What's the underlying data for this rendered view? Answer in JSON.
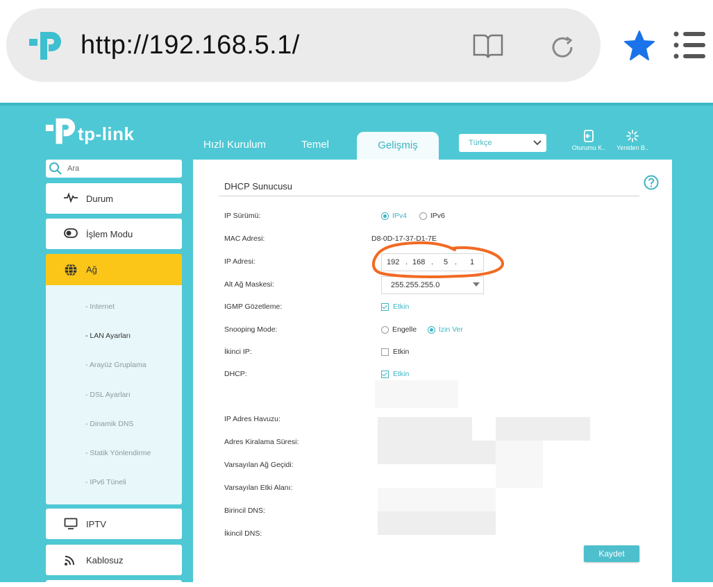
{
  "browser": {
    "url": "http://192.168.5.1/",
    "accent": "#1a73e8"
  },
  "router": {
    "brand": "tp-link",
    "tabs": [
      "Hızlı Kurulum",
      "Temel",
      "Gelişmiş"
    ],
    "active_tab": "Gelişmiş",
    "language": "Türkçe",
    "logout_label": "Oturumu K..",
    "reboot_label": "Yeniden B..",
    "theme_color": "#4ec8d4",
    "highlight_color": "#fcc619"
  },
  "sidebar": {
    "search_placeholder": "Ara",
    "items": {
      "durum": "Durum",
      "islem": "İşlem Modu",
      "ag": "Ağ",
      "iptv": "IPTV",
      "kablosuz": "Kablosuz"
    },
    "submenu": [
      "- Internet",
      "- LAN Ayarları",
      "- Arayüz Gruplama",
      "- DSL Ayarları",
      "- Dinamik DNS",
      "- Statik Yönlendirme",
      "- IPv6 Tüneli"
    ],
    "active_submenu": "- LAN Ayarları"
  },
  "dhcp": {
    "title": "DHCP Sunucusu",
    "labels": {
      "ip_version": "IP Sürümü:",
      "mac": "MAC Adresi:",
      "ip": "IP Adresi:",
      "subnet": "Alt Ağ Maskesi:",
      "igmp": "IGMP Gözetleme:",
      "snooping": "Snooping Mode:",
      "second_ip": "İkinci IP:",
      "dhcp": "DHCP:",
      "pool": "IP Adres Havuzu:",
      "lease": "Adres Kiralama Süresi:",
      "gateway": "Varsayılan Ağ Geçidi:",
      "domain": "Varsayılan Etki Alanı:",
      "dns1": "Birincil DNS:",
      "dns2": "İkincil DNS:"
    },
    "ipv4": "IPv4",
    "ipv6": "IPv6",
    "mac_value": "D8-0D-17-37-D1-7E",
    "ip_octets": [
      "192",
      "168",
      "5",
      "1"
    ],
    "ip_dot": ".",
    "subnet_value": "255.255.255.0",
    "igmp_option": "Etkin",
    "snooping_block": "Engelle",
    "snooping_allow": "İzin Ver",
    "second_ip_option": "Etkin",
    "dhcp_option": "Etkin",
    "save": "Kaydet"
  }
}
